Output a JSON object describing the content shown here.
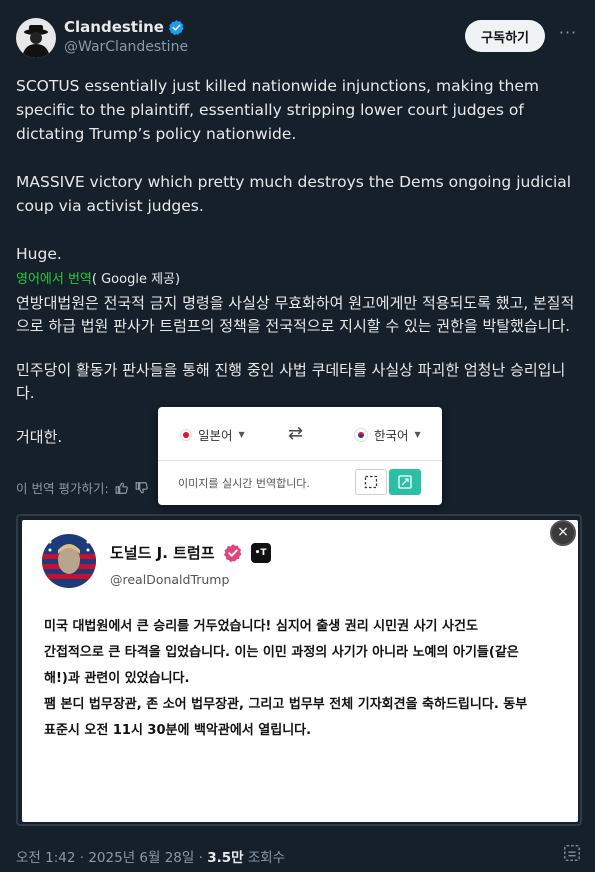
{
  "author": {
    "display_name": "Clandestine",
    "handle": "@WarClandestine",
    "avatar_icon": "spy-silhouette-icon",
    "verified_icon": "verified-badge-icon"
  },
  "actions": {
    "follow_label": "구독하기",
    "more_label": "···"
  },
  "tweet": {
    "paragraphs": [
      "SCOTUS essentially just killed nationwide injunctions, making them specific to the plaintiff, essentially stripping lower court judges of dictating Trump’s policy nationwide.",
      "MASSIVE victory which pretty much destroys the Dems ongoing judicial coup via activist judges.",
      "Huge."
    ]
  },
  "translation": {
    "label_prefix": "영어에서 번역",
    "label_suffix": "( Google 제공)",
    "paragraphs": [
      "연방대법원은 전국적 금지 명령을 사실상 무효화하여 원고에게만 적용되도록 했고, 본질적으로 하급 법원 판사가 트럼프의 정책을 전국적으로 지시할 수 있는 권한을 박탈했습니다.",
      "민주당이 활동가 판사들을 통해 진행 중인 사법 쿠데타를 사실상 파괴한 엄청난 승리입니다.",
      "거대한."
    ],
    "rate_label": "이 번역 평가하기:"
  },
  "translator_popup": {
    "source_lang": "일본어",
    "target_lang": "한국어",
    "swap_symbol": "⇄",
    "hint": "이미지를 실시간 번역합니다."
  },
  "embedded_post": {
    "name": "도널드 J. 트럼프",
    "handle": "@realDonaldTrump",
    "app_label": "•T",
    "lines": [
      "미국 대법원에서 큰 승리를 거두었습니다! 심지어 출생 권리 시민권 사기 사건도",
      "간접적으로 큰 타격을 입었습니다. 이는 이민 과정의 사기가 아니라 노예의 아기들(같은",
      "해!)과 관련이 있었습니다.",
      "팸 본디 법무장관, 존 소어 법무장관, 그리고 법무부 전체 기자회견을 축하드립니다. 동부",
      "표준시 오전 11시 30분에 백악관에서 열립니다."
    ],
    "close_label": "×"
  },
  "footer": {
    "time": "오전 1:42",
    "date": "2025년 6월 28일",
    "views_count": "3.5만",
    "views_label": "조회수",
    "separator": "·"
  },
  "colors": {
    "background": "#15202b",
    "text": "#e7e9ea",
    "muted": "#8b98a5",
    "verified": "#1d9bf0",
    "translation_green": "#27c93f",
    "live_button": "#2bbfa5"
  }
}
